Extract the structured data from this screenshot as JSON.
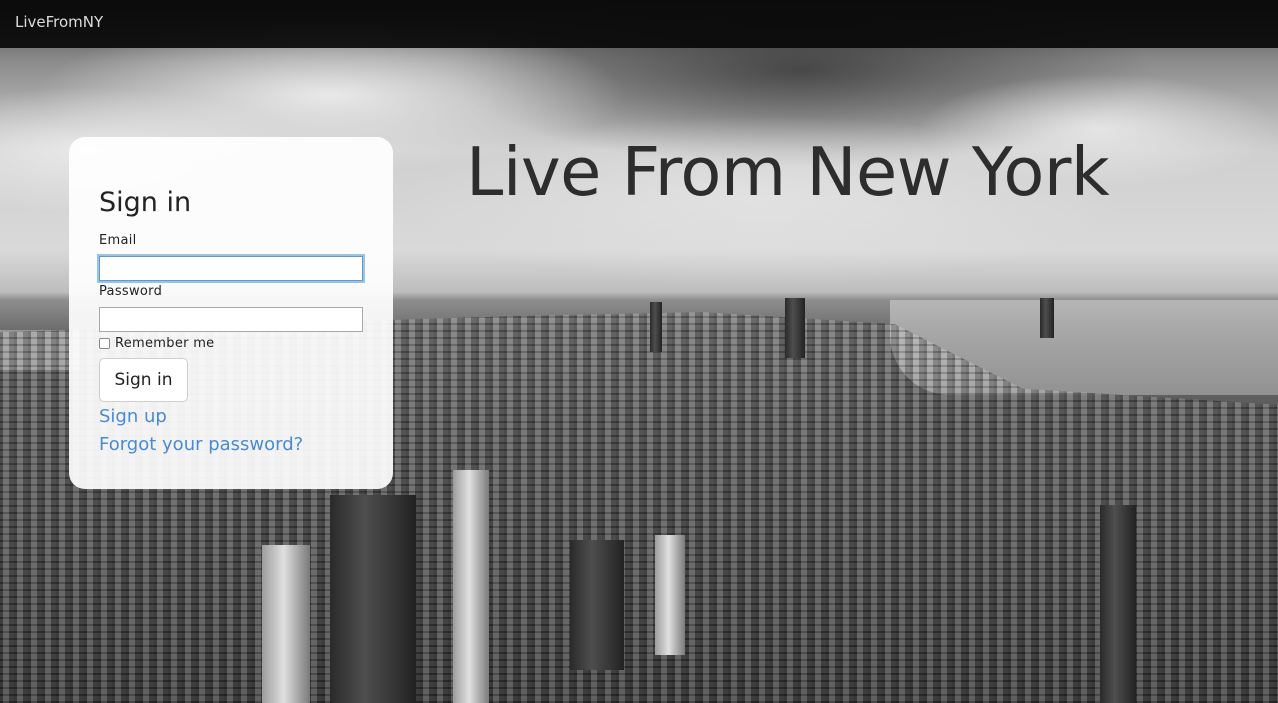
{
  "navbar": {
    "brand": "LiveFromNY"
  },
  "hero": {
    "title": "Live From New York"
  },
  "signin": {
    "heading": "Sign in",
    "email_label": "Email",
    "email_value": "",
    "password_label": "Password",
    "password_value": "",
    "remember_label": "Remember me",
    "remember_checked": false,
    "submit_label": "Sign in",
    "signup_link": "Sign up",
    "forgot_link": "Forgot your password?"
  },
  "colors": {
    "navbar_bg": "#080808",
    "link": "#4a8ad0",
    "focus_ring": "#5b9bd5"
  },
  "background": {
    "icon": "new-york-skyline-photo"
  }
}
